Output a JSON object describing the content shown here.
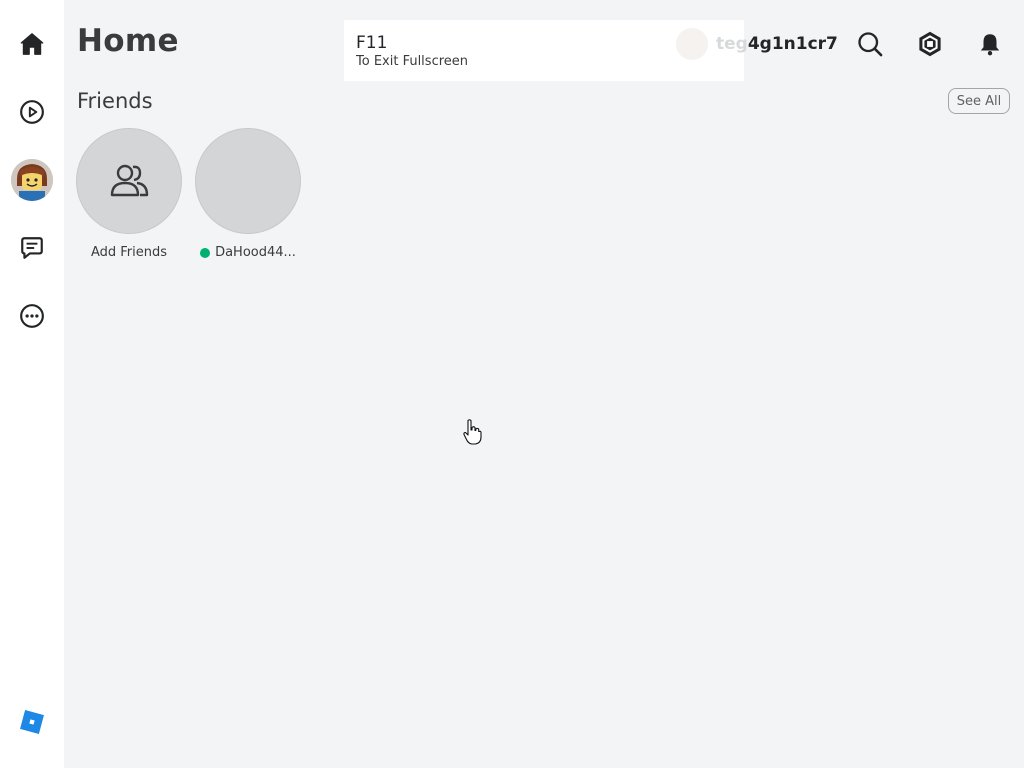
{
  "sidebar": {
    "items": [
      {
        "name": "home",
        "icon": "home-icon"
      },
      {
        "name": "discover",
        "icon": "play-circle-icon"
      },
      {
        "name": "avatar",
        "icon": "avatar-icon"
      },
      {
        "name": "chat",
        "icon": "chat-icon"
      },
      {
        "name": "more",
        "icon": "more-icon"
      }
    ],
    "logo": "roblox-logo-icon"
  },
  "header": {
    "title": "Home",
    "username": "teg4g1n1cr7",
    "username_visible_part": "4g1n1cr7",
    "username_faded_part": "teg",
    "icons": [
      "search-icon",
      "robux-icon",
      "notification-bell-icon"
    ]
  },
  "fullscreen_banner": {
    "key": "F11",
    "hint": "To Exit Fullscreen"
  },
  "friends": {
    "title": "Friends",
    "see_all_label": "See All",
    "items": [
      {
        "label": "Add Friends",
        "online": false
      },
      {
        "label": "DaHood44...",
        "online": true
      }
    ]
  },
  "colors": {
    "background": "#f2f4f5",
    "sidebar": "#ffffff",
    "online": "#00b06f",
    "logo": "#1e88e5"
  }
}
